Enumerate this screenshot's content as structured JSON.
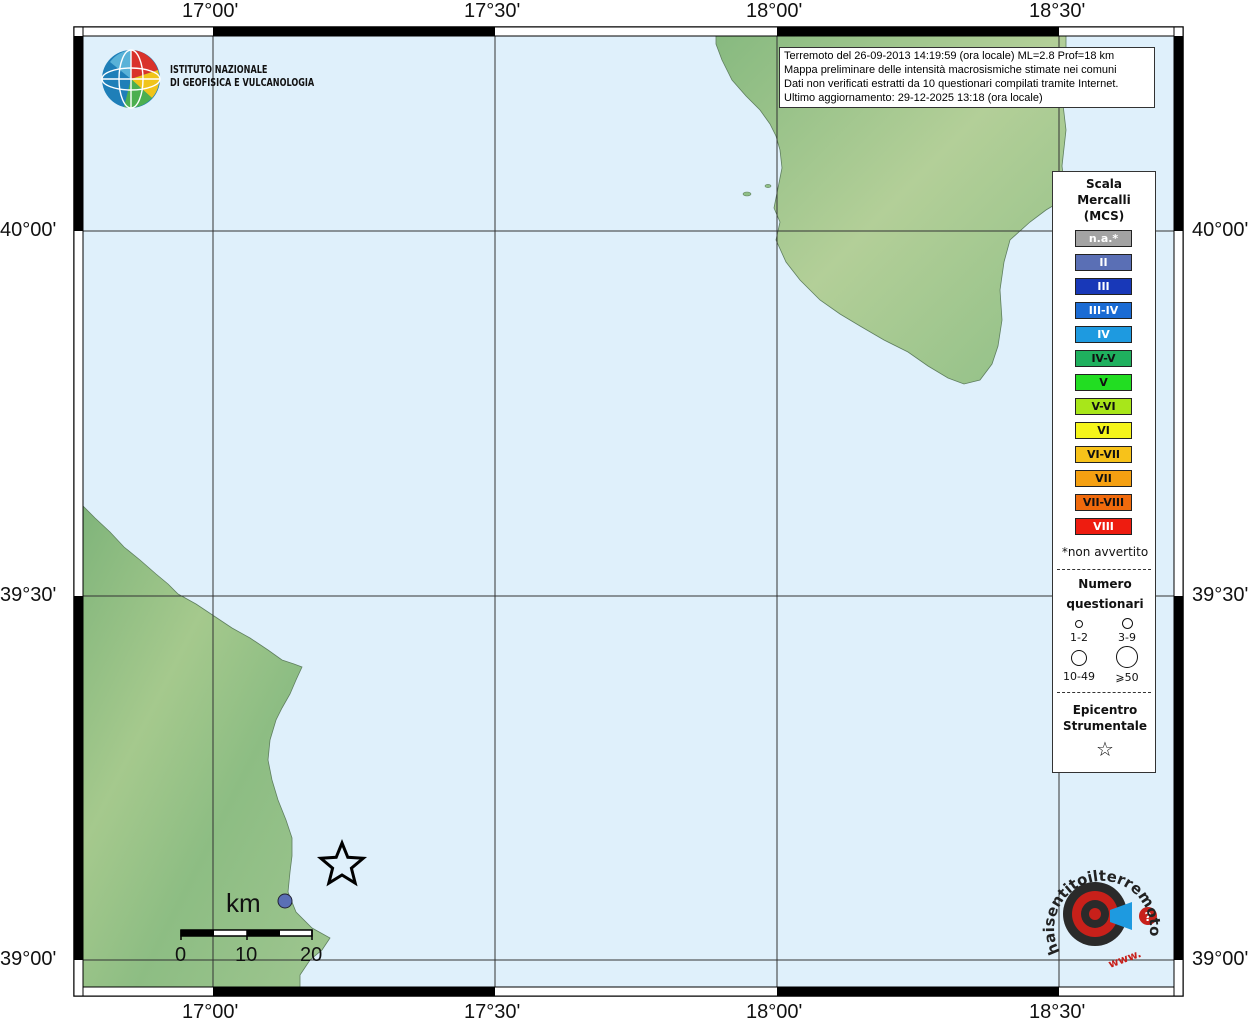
{
  "map": {
    "lon_ticks_top": [
      "17°00'",
      "17°30'",
      "18°00'",
      "18°30'"
    ],
    "lon_ticks_bottom": [
      "17°00'",
      "17°30'",
      "18°00'",
      "18°30'"
    ],
    "lat_ticks_left": [
      "40°00'",
      "39°30'",
      "39°00'"
    ],
    "lat_ticks_right": [
      "40°00'",
      "39°30'",
      "39°00'"
    ],
    "colors": {
      "sea": "#dff0fb",
      "land": "#8fbf84",
      "frame": "#000000",
      "grid": "#333333"
    }
  },
  "institute": {
    "name_line1": "ISTITUTO NAZIONALE",
    "name_line2": "DI GEOFISICA E VULCANOLOGIA"
  },
  "info": {
    "line1": "Terremoto del 26-09-2013 14:19:59 (ora locale) ML=2.8 Prof=18 km",
    "line2": "Mappa preliminare delle intensità macrosismiche stimate nei comuni",
    "line3": "Dati non verificati estratti da 10 questionari compilati tramite Internet.",
    "line4": "Ultimo aggiornamento: 29-12-2025 13:18 (ora locale)"
  },
  "legend": {
    "title": [
      "Scala",
      "Mercalli",
      "(MCS)"
    ],
    "levels": [
      {
        "label": "n.a.*",
        "color": "#a3a3a3",
        "text": "#ffffff"
      },
      {
        "label": "II",
        "color": "#5a6fb5",
        "text": "#ffffff"
      },
      {
        "label": "III",
        "color": "#1838b8",
        "text": "#ffffff"
      },
      {
        "label": "III-IV",
        "color": "#1a6bd4",
        "text": "#ffffff"
      },
      {
        "label": "IV",
        "color": "#1e9ae0",
        "text": "#ffffff"
      },
      {
        "label": "IV-V",
        "color": "#1fb05e",
        "text": "#111111"
      },
      {
        "label": "V",
        "color": "#22dd22",
        "text": "#111111"
      },
      {
        "label": "V-VI",
        "color": "#a8e61a",
        "text": "#111111"
      },
      {
        "label": "VI",
        "color": "#f5f51a",
        "text": "#111111"
      },
      {
        "label": "VI-VII",
        "color": "#f7c21a",
        "text": "#111111"
      },
      {
        "label": "VII",
        "color": "#f5a011",
        "text": "#111111"
      },
      {
        "label": "VII-VIII",
        "color": "#f06a0c",
        "text": "#111111"
      },
      {
        "label": "VIII",
        "color": "#ee1c10",
        "text": "#ffffff"
      }
    ],
    "na_note": "*non avvertito",
    "count_title": [
      "Numero",
      "questionari"
    ],
    "count_classes": [
      "1-2",
      "3-9",
      "10-49",
      "⩾50"
    ],
    "epicenter_title": [
      "Epicentro",
      "Strumentale"
    ],
    "epicenter_symbol": "☆"
  },
  "scale": {
    "unit": "km",
    "labels": [
      "0",
      "10",
      "20"
    ]
  },
  "brand": {
    "text": "haisentitoilterremoto.it",
    "url": "www."
  },
  "observations": [
    {
      "intensity": "II",
      "questionnaires": "1-2"
    }
  ]
}
